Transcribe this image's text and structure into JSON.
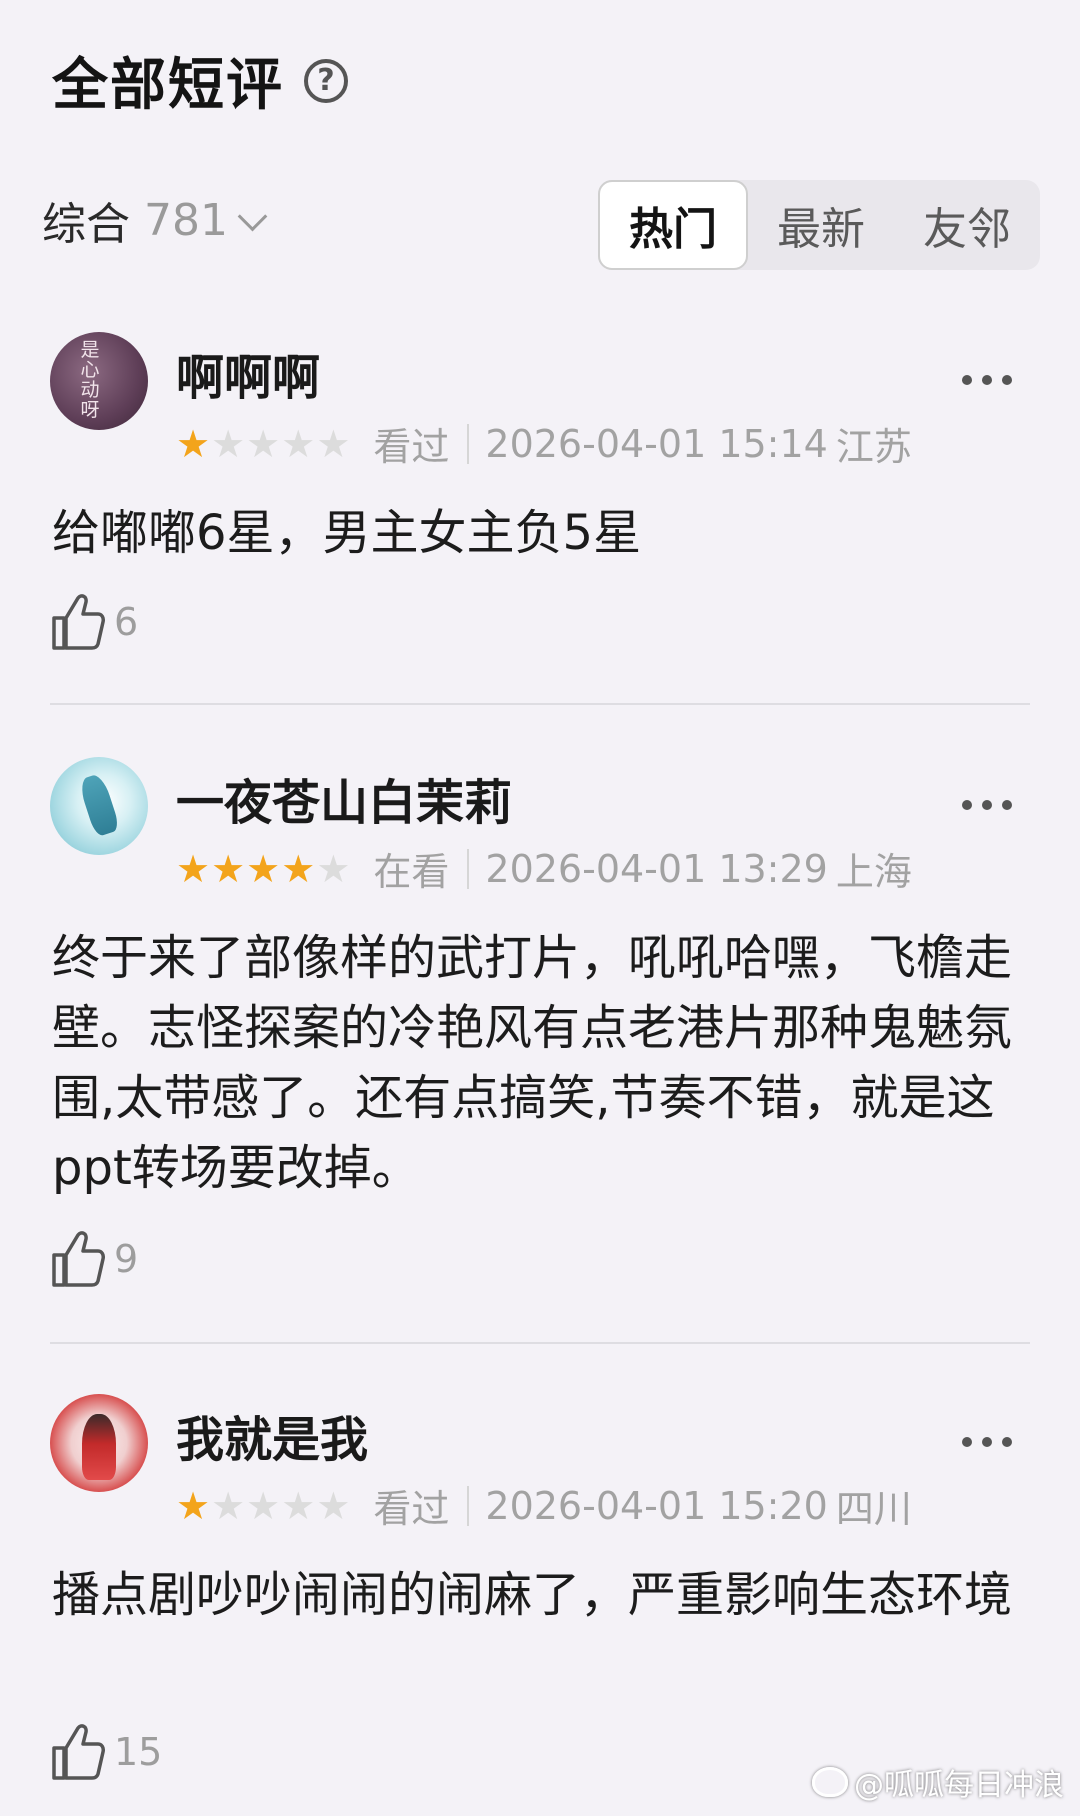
{
  "header": {
    "title": "全部短评",
    "help_icon": "?"
  },
  "filter": {
    "sort_label": "综合",
    "count": "781",
    "tabs": [
      {
        "label": "热门",
        "active": true
      },
      {
        "label": "最新",
        "active": false
      },
      {
        "label": "友邻",
        "active": false
      }
    ]
  },
  "reviews": [
    {
      "username": "啊啊啊",
      "avatar_text": "是心动呀",
      "rating": 1,
      "status": "看过",
      "datetime": "2026-04-01 15:14",
      "location": "江苏",
      "content": "给嘟嘟6星，男主女主负5星",
      "likes": "6"
    },
    {
      "username": "一夜苍山白茉莉",
      "rating": 4,
      "status": "在看",
      "datetime": "2026-04-01 13:29",
      "location": "上海",
      "content": "终于来了部像样的武打片，吼吼哈嘿，飞檐走壁。志怪探案的冷艳风有点老港片那种鬼魅氛围,太带感了。还有点搞笑,节奏不错，就是这ppt转场要改掉。",
      "likes": "9"
    },
    {
      "username": "我就是我",
      "rating": 1,
      "status": "看过",
      "datetime": "2026-04-01 15:20",
      "location": "四川",
      "content": "播点剧吵吵闹闹的闹麻了，严重影响生态环境",
      "likes": "15"
    }
  ],
  "watermark": "@呱呱每日冲浪",
  "colors": {
    "background": "#f4f2f7",
    "star_on": "#f3a41b",
    "star_off": "#dcdcdc",
    "meta_text": "#a2a2a2"
  }
}
